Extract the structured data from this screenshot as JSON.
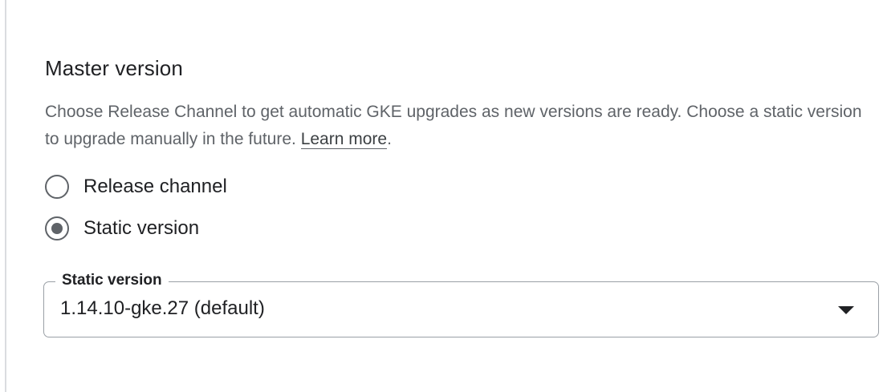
{
  "section": {
    "title": "Master version",
    "description": "Choose Release Channel to get automatic GKE upgrades as new versions are ready. Choose a static version to upgrade manually in the future. ",
    "learn_more_label": "Learn more",
    "description_end": "."
  },
  "radios": {
    "release_channel": {
      "label": "Release channel",
      "checked": false
    },
    "static_version": {
      "label": "Static version",
      "checked": true
    }
  },
  "static_version_select": {
    "legend": "Static version",
    "value": "1.14.10-gke.27 (default)",
    "icon": "arrow-drop-down-icon"
  }
}
